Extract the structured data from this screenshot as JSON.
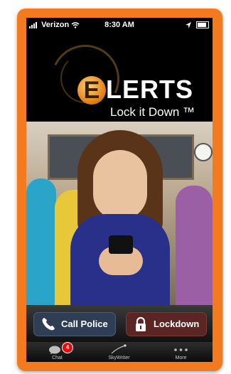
{
  "status_bar": {
    "carrier": "Verizon",
    "time": "8:30 AM"
  },
  "logo": {
    "letter": "E",
    "brand": "LERTS",
    "tagline": "Lock it Down ™"
  },
  "actions": {
    "call_police": "Call Police",
    "lockdown": "Lockdown"
  },
  "tab_bar": {
    "chat": {
      "label": "Chat",
      "badge": "4"
    },
    "skywriter": {
      "label": "SkyWriter"
    },
    "more": {
      "label": "More"
    }
  },
  "colors": {
    "frame": "#f47a1f",
    "call_button": "#2f3d55",
    "lockdown_button": "#5a2522"
  },
  "icons": [
    "signal-icon",
    "wifi-icon",
    "location-icon",
    "battery-icon",
    "phone-icon",
    "lock-icon",
    "chat-icon",
    "skywriter-icon",
    "more-icon"
  ]
}
